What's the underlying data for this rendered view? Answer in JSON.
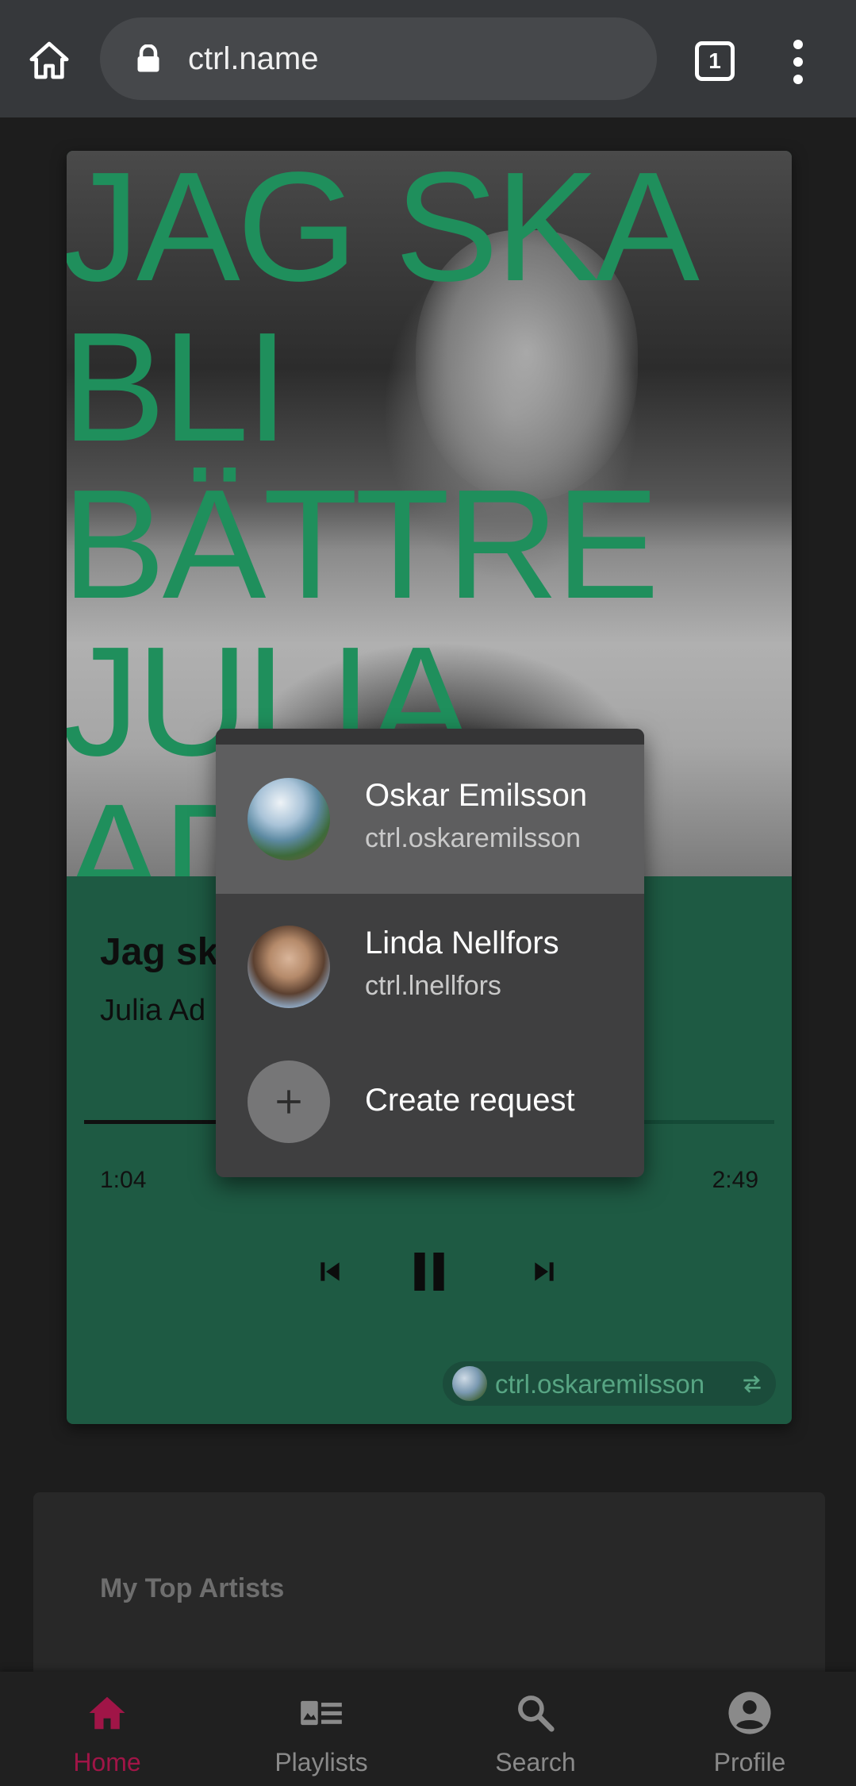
{
  "browser": {
    "url": "ctrl.name",
    "tab_count": "1",
    "icons": [
      "home-icon",
      "lock-icon",
      "tab-switcher-icon",
      "overflow-menu-icon"
    ]
  },
  "album_art": {
    "lines": [
      "JAG SKA",
      "BLI",
      "BÄTTRE",
      "JULIA",
      "AD"
    ],
    "text_color": "#1f8f5c"
  },
  "player": {
    "title": "Jag sk",
    "artist": "Julia Ad",
    "current_time": "1:04",
    "total_time": "2:49",
    "progress": 0.38,
    "device_chip": {
      "label": "ctrl.oskaremilsson",
      "icon": "swap-icon"
    },
    "controls": [
      "skip-previous-icon",
      "pause-icon",
      "skip-next-icon"
    ],
    "card_color": "#1e5a43"
  },
  "popup": {
    "items": [
      {
        "name": "Oskar Emilsson",
        "handle": "ctrl.oskaremilsson",
        "active": true
      },
      {
        "name": "Linda Nellfors",
        "handle": "ctrl.lnellfors",
        "active": false
      }
    ],
    "create_label": "Create request",
    "create_icon": "plus-icon"
  },
  "top_artists": {
    "title": "My Top Artists"
  },
  "nav": {
    "items": [
      {
        "label": "Home",
        "icon": "home-icon",
        "active": true
      },
      {
        "label": "Playlists",
        "icon": "playlists-icon",
        "active": false
      },
      {
        "label": "Search",
        "icon": "search-icon",
        "active": false
      },
      {
        "label": "Profile",
        "icon": "account-circle-icon",
        "active": false
      }
    ],
    "active_color": "#a01547"
  }
}
